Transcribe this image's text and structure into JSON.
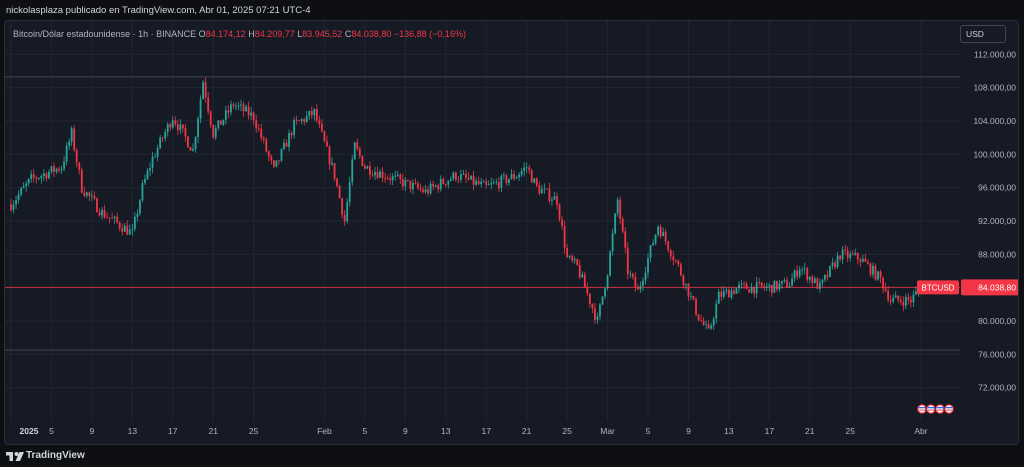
{
  "header": {
    "publisher_text": "nickolasplaza publicado en TradingView.com, Abr 01, 2025 07:21 UTC-4"
  },
  "legend": {
    "symbol": "Bitcoin/Dólar estadounidense · 1h · BINANCE",
    "open_label": "O",
    "open_value": "84.174,12",
    "high_label": "H",
    "high_value": "84.209,77",
    "low_label": "L",
    "low_value": "83.945,52",
    "close_label": "C",
    "close_value": "84.038,80",
    "change_value": "−136,88 (−0,16%)"
  },
  "currency_button": "USD",
  "price_axis": {
    "ticks": [
      "112.000,00",
      "108.000,00",
      "104.000,00",
      "100.000,00",
      "96.000,00",
      "92.000,00",
      "88.000,00",
      "84.000,00",
      "80.000,00",
      "76.000,00",
      "72.000,00"
    ],
    "current_symbol": "BTCUSD",
    "current_value": "84.038,80"
  },
  "time_axis": {
    "ticks": [
      {
        "label": "2025",
        "major": true
      },
      {
        "label": "5",
        "major": false
      },
      {
        "label": "9",
        "major": false
      },
      {
        "label": "13",
        "major": false
      },
      {
        "label": "17",
        "major": false
      },
      {
        "label": "21",
        "major": false
      },
      {
        "label": "25",
        "major": false
      },
      {
        "label": "Feb",
        "major": false
      },
      {
        "label": "5",
        "major": false
      },
      {
        "label": "9",
        "major": false
      },
      {
        "label": "13",
        "major": false
      },
      {
        "label": "17",
        "major": false
      },
      {
        "label": "21",
        "major": false
      },
      {
        "label": "25",
        "major": false
      },
      {
        "label": "Mar",
        "major": false
      },
      {
        "label": "5",
        "major": false
      },
      {
        "label": "9",
        "major": false
      },
      {
        "label": "13",
        "major": false
      },
      {
        "label": "17",
        "major": false
      },
      {
        "label": "21",
        "major": false
      },
      {
        "label": "25",
        "major": false
      },
      {
        "label": "Abr",
        "major": false
      }
    ]
  },
  "horizontal_lines": [
    109300,
    84040,
    76500
  ],
  "colors": {
    "up": "#26a69a",
    "down": "#f23645",
    "background": "#161a25",
    "grid": "#232632",
    "current_price_line": "#f23645",
    "level_line": "#434651"
  },
  "icons": [
    "us-flag-icon",
    "us-flag-icon",
    "us-flag-icon",
    "event-icon"
  ],
  "footer": {
    "brand": "TradingView",
    "logo_icon": "tradingview-logo-icon"
  },
  "chart_data": {
    "type": "candlestick",
    "interval": "1h",
    "ylim": [
      68000,
      116000
    ],
    "x": [
      "2025-01-01",
      "2025-04-01"
    ],
    "path": [
      [
        "2025-01-01",
        94000
      ],
      [
        "2025-01-03",
        97000
      ],
      [
        "2025-01-06",
        98500
      ],
      [
        "2025-01-07",
        102500
      ],
      [
        "2025-01-08",
        96000
      ],
      [
        "2025-01-10",
        93000
      ],
      [
        "2025-01-13",
        90500
      ],
      [
        "2025-01-14",
        96000
      ],
      [
        "2025-01-15",
        99500
      ],
      [
        "2025-01-17",
        104500
      ],
      [
        "2025-01-19",
        100500
      ],
      [
        "2025-01-20",
        108800
      ],
      [
        "2025-01-21",
        102500
      ],
      [
        "2025-01-23",
        106000
      ],
      [
        "2025-01-25",
        104500
      ],
      [
        "2025-01-27",
        98000
      ],
      [
        "2025-01-29",
        103500
      ],
      [
        "2025-01-31",
        105000
      ],
      [
        "2025-02-02",
        97500
      ],
      [
        "2025-02-03",
        92000
      ],
      [
        "2025-02-04",
        101000
      ],
      [
        "2025-02-05",
        98500
      ],
      [
        "2025-02-08",
        97000
      ],
      [
        "2025-02-11",
        95500
      ],
      [
        "2025-02-14",
        97500
      ],
      [
        "2025-02-17",
        96000
      ],
      [
        "2025-02-20",
        97500
      ],
      [
        "2025-02-21",
        98500
      ],
      [
        "2025-02-22",
        96000
      ],
      [
        "2025-02-24",
        94500
      ],
      [
        "2025-02-25",
        87500
      ],
      [
        "2025-02-26",
        86500
      ],
      [
        "2025-02-28",
        80000
      ],
      [
        "2025-03-01",
        86000
      ],
      [
        "2025-03-02",
        94500
      ],
      [
        "2025-03-03",
        86000
      ],
      [
        "2025-03-04",
        83500
      ],
      [
        "2025-03-06",
        91500
      ],
      [
        "2025-03-08",
        86500
      ],
      [
        "2025-03-10",
        80500
      ],
      [
        "2025-03-11",
        78500
      ],
      [
        "2025-03-12",
        83000
      ],
      [
        "2025-03-14",
        84000
      ],
      [
        "2025-03-17",
        84000
      ],
      [
        "2025-03-19",
        84500
      ],
      [
        "2025-03-20",
        86500
      ],
      [
        "2025-03-22",
        84000
      ],
      [
        "2025-03-24",
        88000
      ],
      [
        "2025-03-26",
        87500
      ],
      [
        "2025-03-28",
        85000
      ],
      [
        "2025-03-29",
        82500
      ],
      [
        "2025-03-31",
        82500
      ],
      [
        "2025-04-01",
        84038.8
      ]
    ]
  }
}
